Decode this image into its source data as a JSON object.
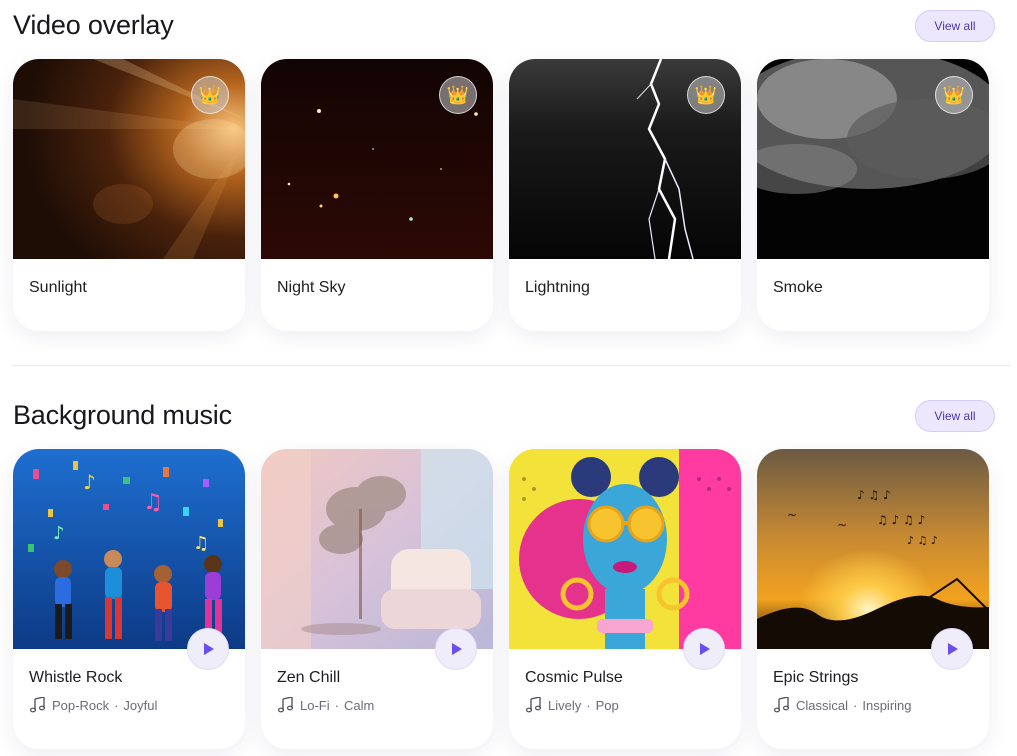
{
  "video_overlay": {
    "title": "Video overlay",
    "view_all": "View all",
    "premium_icon": "crown-icon",
    "items": [
      {
        "name": "Sunlight"
      },
      {
        "name": "Night Sky"
      },
      {
        "name": "Lightning"
      },
      {
        "name": "Smoke"
      }
    ]
  },
  "background_music": {
    "title": "Background music",
    "view_all": "View all",
    "play_icon": "play-icon",
    "music_icon": "music-notes-icon",
    "items": [
      {
        "name": "Whistle Rock",
        "tag1": "Pop-Rock",
        "tag2": "Joyful"
      },
      {
        "name": "Zen Chill",
        "tag1": "Lo-Fi",
        "tag2": "Calm"
      },
      {
        "name": "Cosmic Pulse",
        "tag1": "Lively",
        "tag2": "Pop"
      },
      {
        "name": "Epic Strings",
        "tag1": "Classical",
        "tag2": "Inspiring"
      }
    ]
  },
  "colors": {
    "accent": "#6a4cf0",
    "view_all_bg": "#ece7fd"
  }
}
